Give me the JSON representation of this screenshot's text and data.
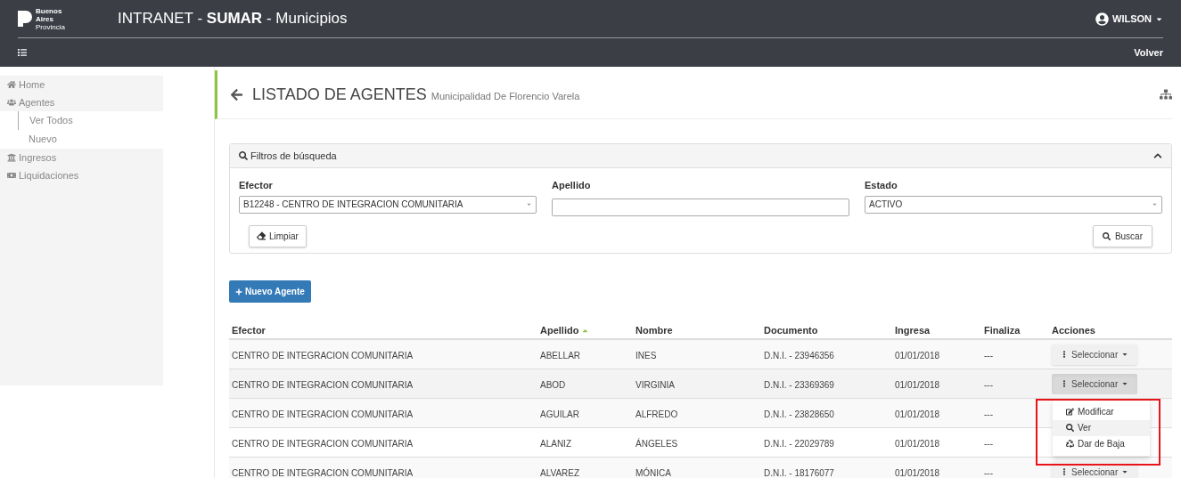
{
  "header": {
    "logo_text": [
      "Buenos",
      "Aires",
      "Provincia"
    ],
    "title_parts": [
      "INTRANET - ",
      "SUMAR",
      " - Municipios"
    ],
    "user": "WILSON",
    "back": "Volver"
  },
  "sidebar": {
    "items": [
      {
        "label": "Home"
      },
      {
        "label": "Agentes",
        "children": [
          {
            "label": "Ver Todos",
            "selected": true
          },
          {
            "label": "Nuevo",
            "selected": false
          }
        ]
      },
      {
        "label": "Ingresos"
      },
      {
        "label": "Liquidaciones"
      }
    ]
  },
  "page": {
    "title": "LISTADO DE AGENTES",
    "subtitle": "Municipalidad De Florencio Varela"
  },
  "filters": {
    "title": "Filtros de búsqueda",
    "expanded": true,
    "fields": [
      {
        "label": "Efector",
        "kind": "select",
        "value": "B12248 - CENTRO DE INTEGRACION COMUNITARIA"
      },
      {
        "label": "Apellido",
        "kind": "text"
      },
      {
        "label": "Estado",
        "kind": "select",
        "value": "ACTIVO"
      }
    ],
    "clear_button": "Limpiar",
    "search_button": "Buscar"
  },
  "new_button": "Nuevo Agente",
  "table": {
    "columns": [
      {
        "label": "Efector",
        "sorted": false
      },
      {
        "label": "Apellido",
        "sorted": true
      },
      {
        "label": "Nombre",
        "sorted": false
      },
      {
        "label": "Documento",
        "sorted": false
      },
      {
        "label": "Ingresa",
        "sorted": false
      },
      {
        "label": "Finaliza",
        "sorted": false
      },
      {
        "label": "Acciones",
        "sorted": false
      }
    ],
    "rows": [
      {
        "cells": [
          "CENTRO DE INTEGRACION COMUNITARIA",
          "ABELLAR",
          "INES",
          "D.N.I. - 23946356",
          "01/01/2018",
          "---"
        ],
        "action": "Seleccionar",
        "menu_open": false
      },
      {
        "cells": [
          "CENTRO DE INTEGRACION COMUNITARIA",
          "ABOD",
          "VIRGINIA",
          "D.N.I. - 23369369",
          "01/01/2018",
          "---"
        ],
        "action": "Seleccionar",
        "menu_open": true
      },
      {
        "cells": [
          "CENTRO DE INTEGRACION COMUNITARIA",
          "AGUILAR",
          "ALFREDO",
          "D.N.I. - 23828650",
          "01/01/2018",
          "---"
        ],
        "menu_open": false
      },
      {
        "cells": [
          "CENTRO DE INTEGRACION COMUNITARIA",
          "ALANIZ",
          "ÁNGELES",
          "D.N.I. - 22029789",
          "01/01/2018",
          "---"
        ],
        "menu_open": false
      },
      {
        "cells": [
          "CENTRO DE INTEGRACION COMUNITARIA",
          "ALVAREZ",
          "MÓNICA",
          "D.N.I. - 18176077",
          "01/01/2018",
          "---"
        ],
        "action": "Seleccionar",
        "menu_open": false
      }
    ]
  },
  "action_menu": [
    {
      "label": "Modificar",
      "selected": false
    },
    {
      "label": "Ver",
      "selected": true
    },
    {
      "label": "Dar de Baja",
      "selected": false
    }
  ]
}
